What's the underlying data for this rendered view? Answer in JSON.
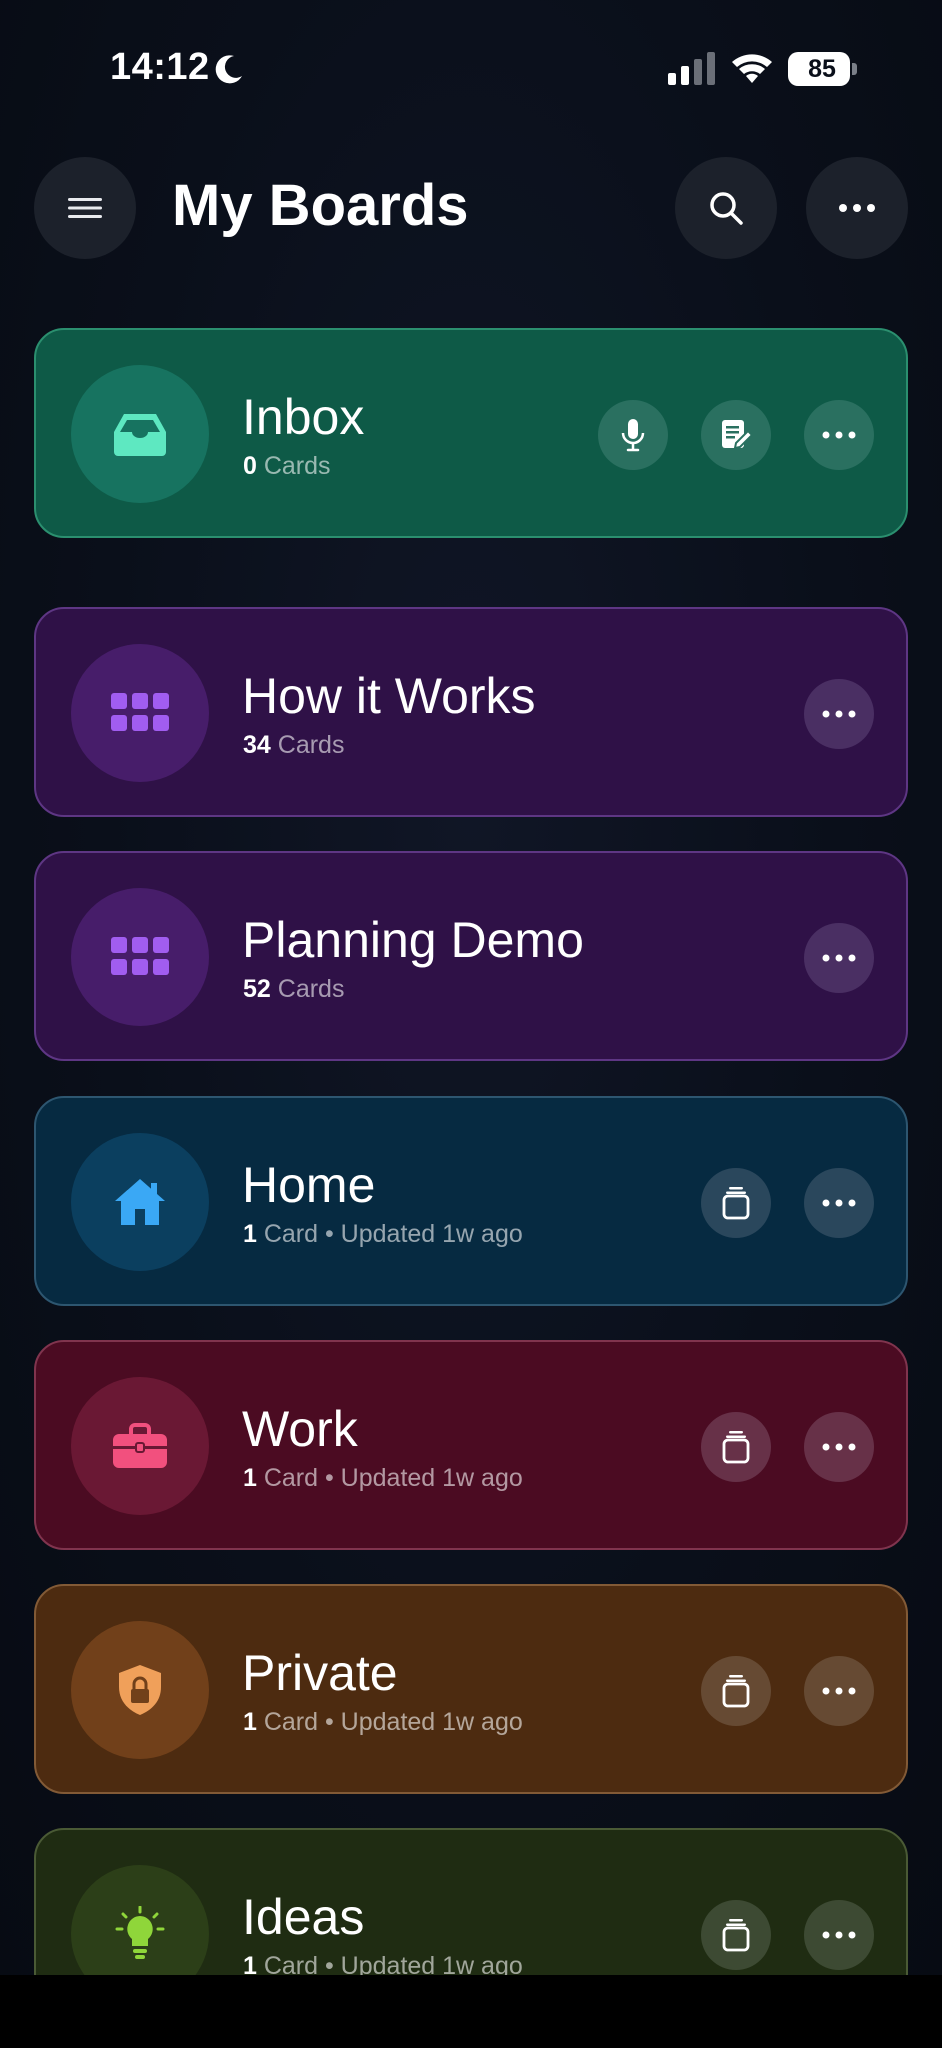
{
  "status_bar": {
    "time": "14:12",
    "battery": "85"
  },
  "header": {
    "title": "My Boards"
  },
  "boards": [
    {
      "name": "Inbox",
      "count": "0",
      "meta": " Cards",
      "icon": "inbox-tray-icon",
      "accent": "#5ee8c1"
    },
    {
      "name": "How it Works",
      "count": "34",
      "meta": " Cards",
      "icon": "grid-icon",
      "accent": "#a15df0"
    },
    {
      "name": "Planning Demo",
      "count": "52",
      "meta": " Cards",
      "icon": "grid-icon",
      "accent": "#a15df0"
    },
    {
      "name": "Home",
      "count": "1",
      "meta": " Card • Updated 1w ago",
      "icon": "house-icon",
      "accent": "#3aa8f5"
    },
    {
      "name": "Work",
      "count": "1",
      "meta": " Card • Updated 1w ago",
      "icon": "briefcase-icon",
      "accent": "#f2507e"
    },
    {
      "name": "Private",
      "count": "1",
      "meta": " Card • Updated 1w ago",
      "icon": "shield-lock-icon",
      "accent": "#f0a05a"
    },
    {
      "name": "Ideas",
      "count": "1",
      "meta": " Card • Updated 1w ago",
      "icon": "lightbulb-icon",
      "accent": "#8fd63a"
    }
  ]
}
